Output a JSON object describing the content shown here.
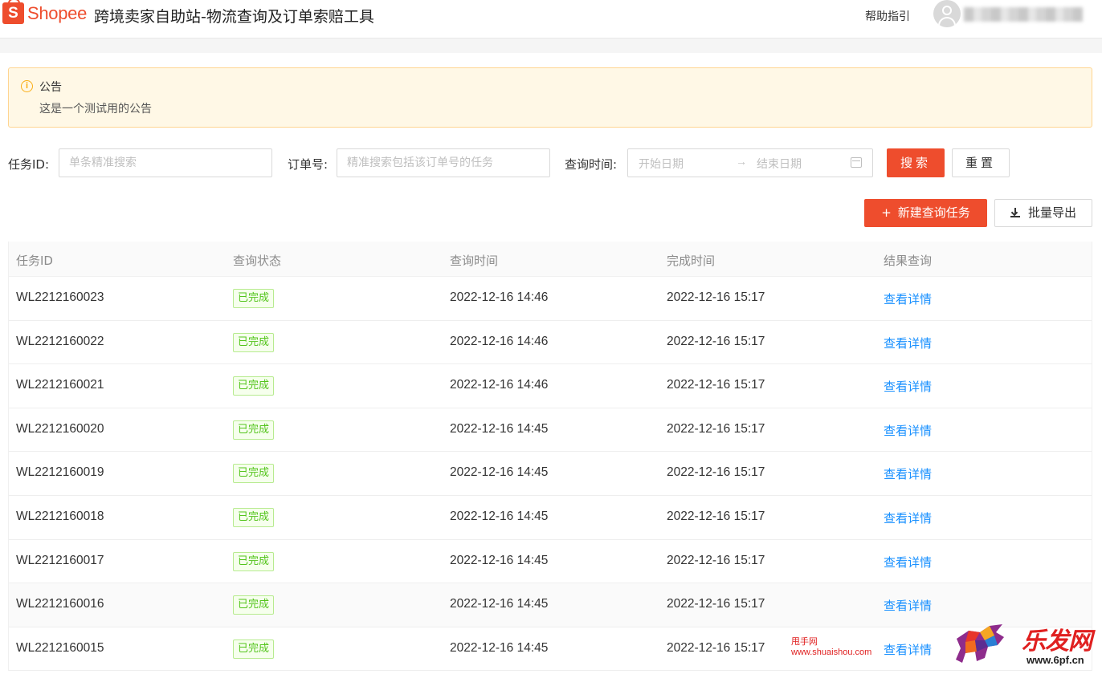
{
  "header": {
    "logo_letter": "S",
    "logo_text": "Shopee",
    "title": "跨境卖家自助站-物流查询及订单索赔工具",
    "help_label": "帮助指引"
  },
  "notice": {
    "icon": "info-circle-icon",
    "title": "公告",
    "text": "这是一个测试用的公告"
  },
  "filters": {
    "task_id_label": "任务ID:",
    "task_id_placeholder": "单条精准搜索",
    "order_label": "订单号:",
    "order_placeholder": "精准搜索包括该订单号的任务",
    "time_label": "查询时间:",
    "start_placeholder": "开始日期",
    "range_arrow": "→",
    "end_placeholder": "结束日期",
    "search_label": "搜索",
    "reset_label": "重置"
  },
  "actions": {
    "new_glyph": "+",
    "new_label": "新建查询任务",
    "export_label": "批量导出"
  },
  "table": {
    "columns": [
      "任务ID",
      "查询状态",
      "查询时间",
      "完成时间",
      "结果查询"
    ],
    "rows": [
      {
        "id": "WL2212160023",
        "status": "已完成",
        "query_time": "2022-12-16 14:46",
        "done_time": "2022-12-16 15:17",
        "action": "查看详情"
      },
      {
        "id": "WL2212160022",
        "status": "已完成",
        "query_time": "2022-12-16 14:46",
        "done_time": "2022-12-16 15:17",
        "action": "查看详情"
      },
      {
        "id": "WL2212160021",
        "status": "已完成",
        "query_time": "2022-12-16 14:46",
        "done_time": "2022-12-16 15:17",
        "action": "查看详情"
      },
      {
        "id": "WL2212160020",
        "status": "已完成",
        "query_time": "2022-12-16 14:45",
        "done_time": "2022-12-16 15:17",
        "action": "查看详情"
      },
      {
        "id": "WL2212160019",
        "status": "已完成",
        "query_time": "2022-12-16 14:45",
        "done_time": "2022-12-16 15:17",
        "action": "查看详情"
      },
      {
        "id": "WL2212160018",
        "status": "已完成",
        "query_time": "2022-12-16 14:45",
        "done_time": "2022-12-16 15:17",
        "action": "查看详情"
      },
      {
        "id": "WL2212160017",
        "status": "已完成",
        "query_time": "2022-12-16 14:45",
        "done_time": "2022-12-16 15:17",
        "action": "查看详情"
      },
      {
        "id": "WL2212160016",
        "status": "已完成",
        "query_time": "2022-12-16 14:45",
        "done_time": "2022-12-16 15:17",
        "action": "查看详情"
      },
      {
        "id": "WL2212160015",
        "status": "已完成",
        "query_time": "2022-12-16 14:45",
        "done_time": "2022-12-16 15:17",
        "action": "查看详情"
      }
    ]
  },
  "watermark": {
    "line1": "甩手网",
    "line2": "www.shuaishou.com",
    "brand": "乐发网",
    "url": "www.6pf.cn"
  },
  "colors": {
    "brand": "#ee4d2d",
    "link": "#1890ff",
    "success": "#52c41a",
    "notice_bg": "#fff8e6"
  }
}
